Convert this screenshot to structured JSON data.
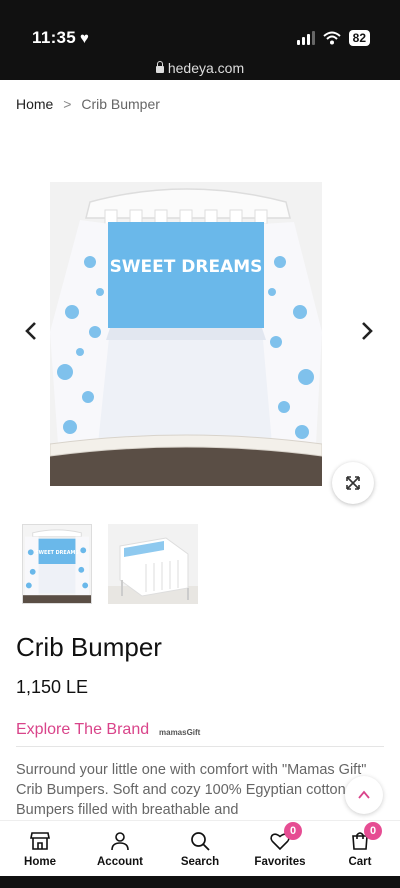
{
  "status_bar": {
    "time": "11:35",
    "battery": "82",
    "url": "hedeya.com"
  },
  "breadcrumb": {
    "home": "Home",
    "separator": ">",
    "current": "Crib Bumper"
  },
  "gallery": {
    "main_image_alt": "Crib with blue Sweet Dreams bumper",
    "main_image_text": "SWEET DREAMS",
    "thumbnail_1_text": "SWEET DREAMS",
    "prev_icon": "chevron-left-icon",
    "next_icon": "chevron-right-icon",
    "zoom_icon": "expand-icon"
  },
  "product": {
    "title": "Crib Bumper",
    "price": "1,150 LE",
    "brand_link": "Explore The Brand",
    "brand_logo": "mamasGift",
    "description": "Surround your little one with comfort with \"Mamas Gift\" Crib Bumpers. Soft and cozy 100% Egyptian cotton Crib Bumpers filled with breathable and"
  },
  "bottom_nav": {
    "items": [
      {
        "label": "Home",
        "icon": "store-icon"
      },
      {
        "label": "Account",
        "icon": "user-icon"
      },
      {
        "label": "Search",
        "icon": "search-icon"
      },
      {
        "label": "Favorites",
        "icon": "heart-icon",
        "badge": "0"
      },
      {
        "label": "Cart",
        "icon": "cart-icon",
        "badge": "0"
      }
    ]
  },
  "colors": {
    "accent": "#d9448a",
    "badge": "#e64d93",
    "bumper_blue": "#6ab8ea"
  }
}
